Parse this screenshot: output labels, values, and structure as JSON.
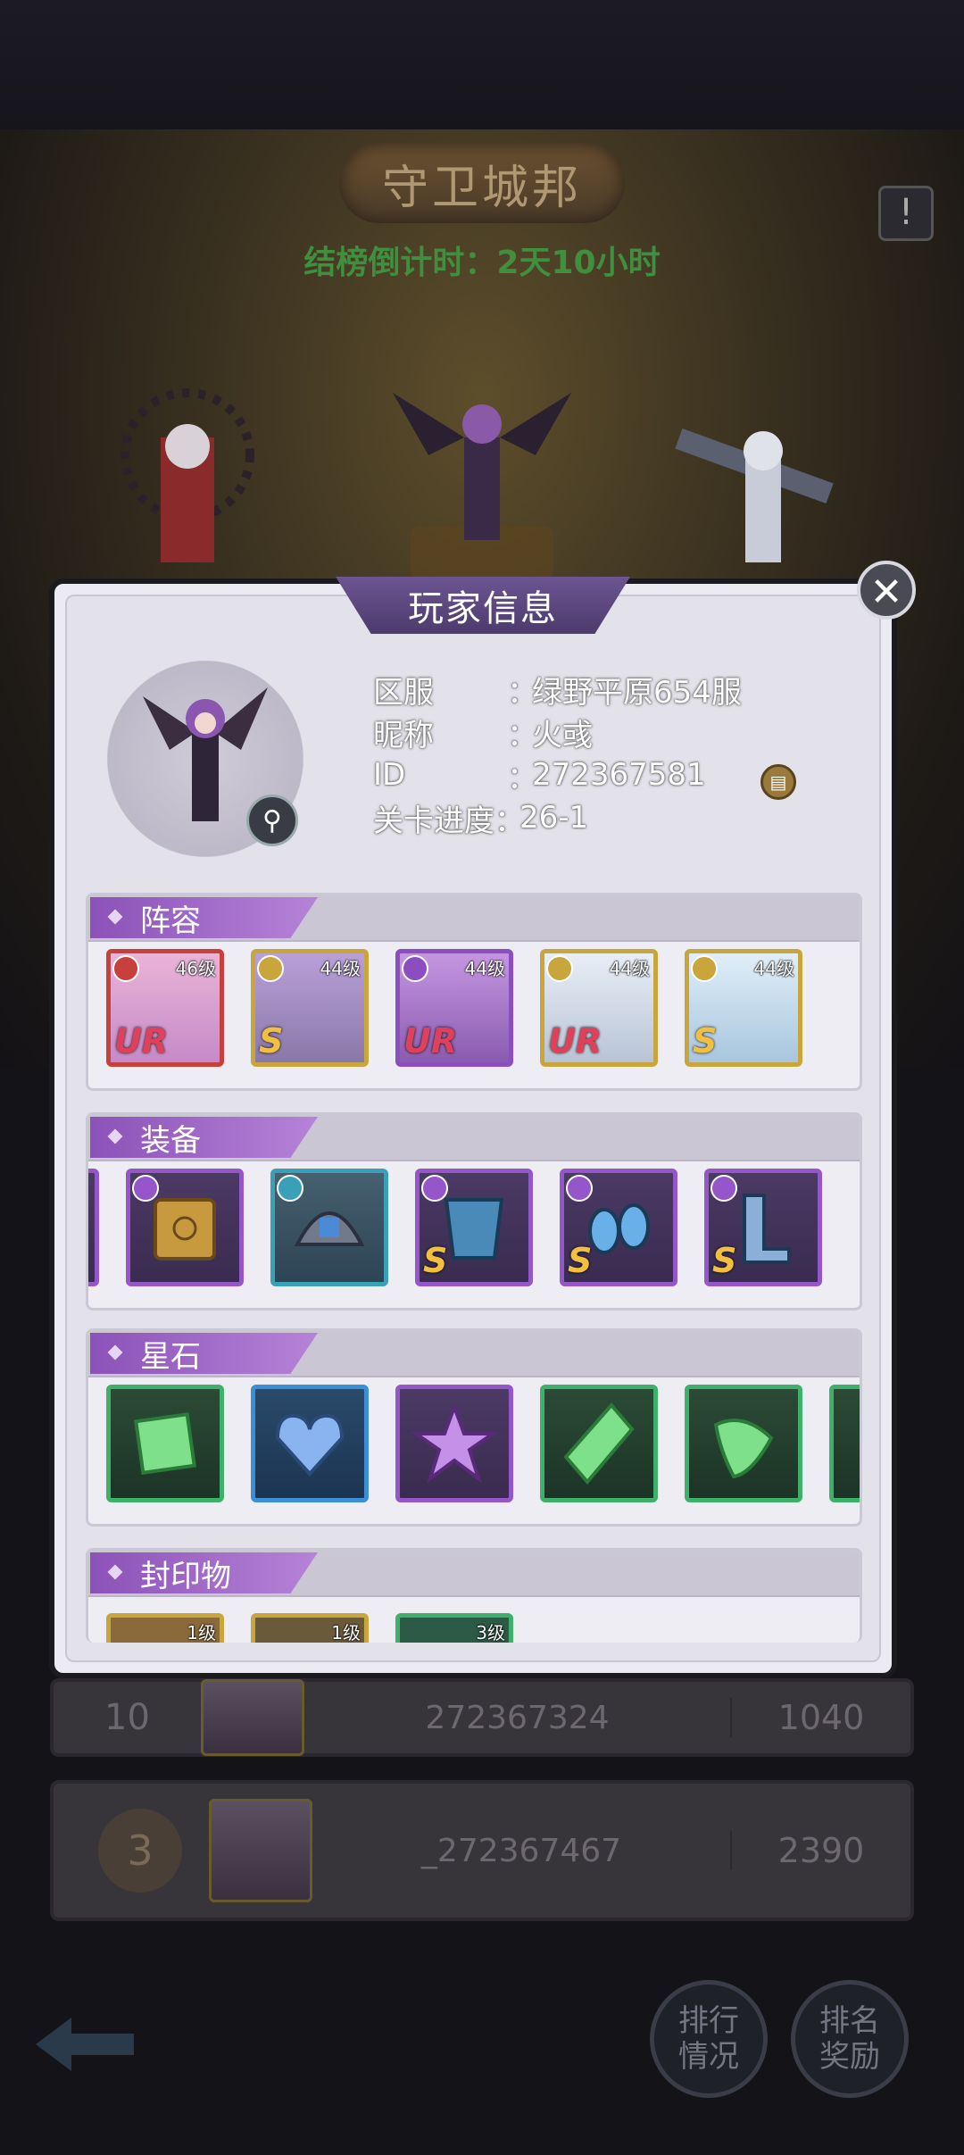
{
  "header": {
    "title": "守卫城邦",
    "countdown": "结榜倒计时：2天10小时",
    "info_icon": "exclamation-icon"
  },
  "ranking_rows": [
    {
      "rank": "10",
      "player_id": "272367324",
      "score": "1040"
    },
    {
      "rank": "3",
      "player_id": "_272367467",
      "score": "2390"
    }
  ],
  "bottom_nav": {
    "ranking_label": "排行\n情况",
    "reward_label": "排名\n奖励"
  },
  "panel": {
    "title": "玩家信息",
    "close_icon": "close-icon",
    "info": {
      "server_label": "区服",
      "server_value": "绿野平原654服",
      "nick_label": "昵称",
      "nick_value": "火彧",
      "id_label": "ID",
      "id_value": "272367581",
      "progress_label": "关卡进度",
      "progress_value": "26-1",
      "separator": "："
    },
    "sections": {
      "lineup": {
        "title": "阵容",
        "heroes": [
          {
            "level": "46级",
            "rarity": "UR",
            "rarity_color": "#e0405a",
            "frame": "red"
          },
          {
            "level": "44级",
            "rarity": "S",
            "rarity_color": "#f2c040",
            "frame": "gold"
          },
          {
            "level": "44级",
            "rarity": "UR",
            "rarity_color": "#e0405a",
            "frame": "purple"
          },
          {
            "level": "44级",
            "rarity": "UR",
            "rarity_color": "#e0405a",
            "frame": "gold"
          },
          {
            "level": "44级",
            "rarity": "S",
            "rarity_color": "#f2c040",
            "frame": "gold"
          }
        ]
      },
      "equipment": {
        "title": "装备",
        "items": [
          {
            "name": "book-icon",
            "rarity": ""
          },
          {
            "name": "helmet-icon",
            "rarity": ""
          },
          {
            "name": "armor-icon",
            "rarity": "S"
          },
          {
            "name": "earring-icon",
            "rarity": "S"
          },
          {
            "name": "boots-icon",
            "rarity": "S"
          }
        ]
      },
      "stars": {
        "title": "星石",
        "items": [
          {
            "name": "square-gem-icon",
            "color": "#7ee08a"
          },
          {
            "name": "heart-gem-icon",
            "color": "#8ab4f0"
          },
          {
            "name": "star-gem-icon",
            "color": "#c490e8"
          },
          {
            "name": "diamond-gem-icon",
            "color": "#7ee08a"
          },
          {
            "name": "triangle-gem-icon",
            "color": "#7ee08a"
          }
        ]
      },
      "seals": {
        "title": "封印物",
        "items": [
          {
            "level": "1级"
          },
          {
            "level": "1级"
          },
          {
            "level": "3级"
          }
        ]
      }
    }
  }
}
